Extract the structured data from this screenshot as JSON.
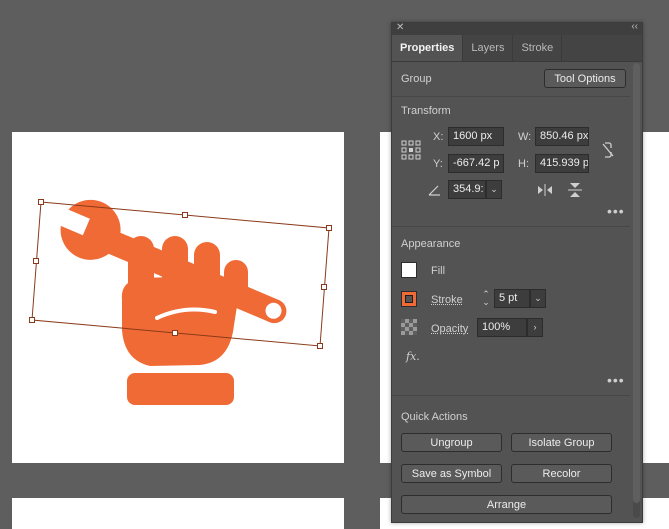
{
  "canvas": {
    "artwork": {
      "colors": {
        "fill": "#f06a35",
        "selection": "#8a3a1a"
      }
    }
  },
  "panel": {
    "tabs": [
      "Properties",
      "Layers",
      "Stroke"
    ],
    "active_tab": "Properties",
    "selection_type": "Group",
    "tool_options_label": "Tool Options",
    "transform": {
      "title": "Transform",
      "x_label": "X:",
      "x_value": "1600 px",
      "y_label": "Y:",
      "y_value": "-667.42 p",
      "w_label": "W:",
      "w_value": "850.46 px",
      "h_label": "H:",
      "h_value": "415.939 p",
      "angle_value": "354.9:"
    },
    "appearance": {
      "title": "Appearance",
      "fill_label": "Fill",
      "fill_color": "#ffffff",
      "stroke_label": "Stroke",
      "stroke_color": "#f06a35",
      "stroke_weight": "5 pt",
      "opacity_label": "Opacity",
      "opacity_value": "100%",
      "fx_label": "fx."
    },
    "quick_actions": {
      "title": "Quick Actions",
      "ungroup": "Ungroup",
      "isolate_group": "Isolate Group",
      "save_as_symbol": "Save as Symbol",
      "recolor": "Recolor",
      "arrange": "Arrange"
    }
  }
}
